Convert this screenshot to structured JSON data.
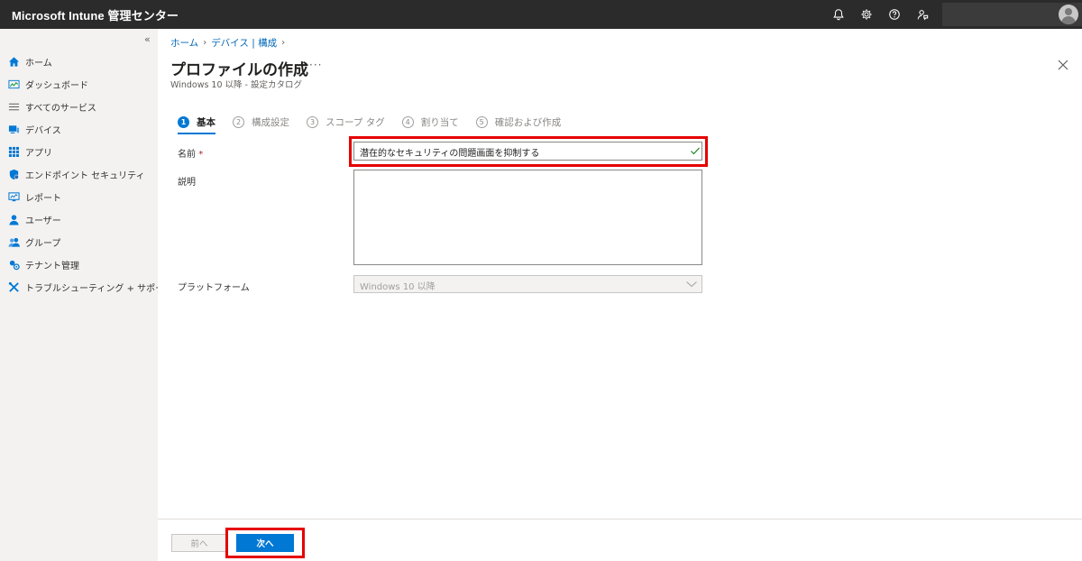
{
  "app": {
    "title": "Microsoft Intune 管理センター"
  },
  "topbar": {
    "icons": [
      "bell-icon",
      "gear-icon",
      "help-icon",
      "feedback-icon"
    ],
    "account_avatar": "avatar"
  },
  "sidebar": {
    "collapse_glyph": "«",
    "items": [
      {
        "label": "ホーム",
        "icon": "home-icon"
      },
      {
        "label": "ダッシュボード",
        "icon": "dashboard-icon"
      },
      {
        "label": "すべてのサービス",
        "icon": "list-icon"
      },
      {
        "label": "デバイス",
        "icon": "devices-icon"
      },
      {
        "label": "アプリ",
        "icon": "apps-icon"
      },
      {
        "label": "エンドポイント セキュリティ",
        "icon": "shield-icon"
      },
      {
        "label": "レポート",
        "icon": "reports-icon"
      },
      {
        "label": "ユーザー",
        "icon": "user-icon"
      },
      {
        "label": "グループ",
        "icon": "group-icon"
      },
      {
        "label": "テナント管理",
        "icon": "tenant-icon"
      },
      {
        "label": "トラブルシューティング + サポート",
        "icon": "tools-icon"
      }
    ]
  },
  "breadcrumb": {
    "items": [
      "ホーム",
      "デバイス | 構成"
    ]
  },
  "page": {
    "title": "プロファイルの作成",
    "more_glyph": "···",
    "subtitle": "Windows 10 以降 - 設定カタログ"
  },
  "wizard": {
    "steps": [
      {
        "num": "1",
        "label": "基本",
        "active": true
      },
      {
        "num": "2",
        "label": "構成設定",
        "active": false
      },
      {
        "num": "3",
        "label": "スコープ タグ",
        "active": false
      },
      {
        "num": "4",
        "label": "割り当て",
        "active": false
      },
      {
        "num": "5",
        "label": "確認および作成",
        "active": false
      }
    ]
  },
  "form": {
    "name_label": "名前",
    "required_mark": "*",
    "name_value": "潜在的なセキュリティの問題画面を抑制する",
    "description_label": "説明",
    "description_value": "",
    "platform_label": "プラットフォーム",
    "platform_value": "Windows 10 以降"
  },
  "footer": {
    "prev_label": "前へ",
    "next_label": "次へ"
  },
  "colors": {
    "accent": "#0078d4",
    "highlight": "#e60000",
    "topbar": "#2b2b2b"
  }
}
